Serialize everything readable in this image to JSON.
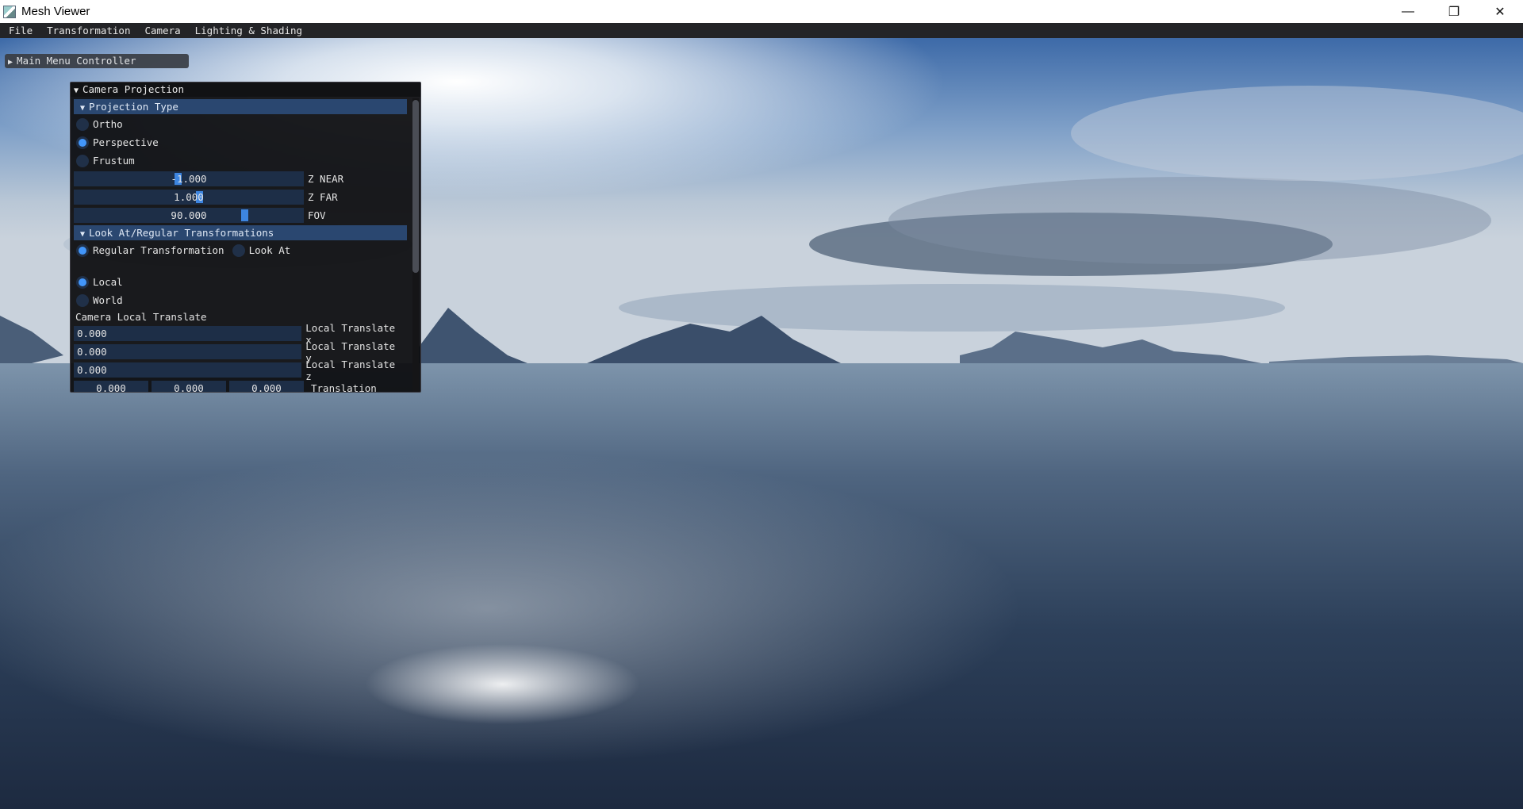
{
  "window": {
    "title": "Mesh Viewer"
  },
  "menubar": {
    "items": [
      "File",
      "Transformation",
      "Camera",
      "Lighting & Shading"
    ]
  },
  "main_menu": {
    "label": "Main Menu Controller"
  },
  "camera_projection": {
    "title": "Camera Projection",
    "projection_type": {
      "header": "Projection Type",
      "options": [
        {
          "label": "Ortho",
          "selected": false
        },
        {
          "label": "Perspective",
          "selected": true
        },
        {
          "label": "Frustum",
          "selected": false
        }
      ],
      "z_near": {
        "value": "-1.000",
        "label": "Z NEAR"
      },
      "z_far": {
        "value": "1.000",
        "label": "Z FAR"
      },
      "fov": {
        "value": "90.000",
        "label": "FOV"
      }
    },
    "look_at": {
      "header": "Look At/Regular Transformations",
      "mode_regular": "Regular Transformation",
      "mode_lookat": "Look At",
      "space_local": "Local",
      "space_world": "World",
      "local_translate_title": "Camera Local Translate",
      "translate_x": {
        "value": "0.000",
        "label": "Local Translate x"
      },
      "translate_y": {
        "value": "0.000",
        "label": "Local Translate y"
      },
      "translate_z": {
        "value": "0.000",
        "label": "Local Translate z"
      },
      "translation": {
        "values": [
          "0.000",
          "0.000",
          "0.000"
        ],
        "label": "Translation"
      }
    }
  }
}
